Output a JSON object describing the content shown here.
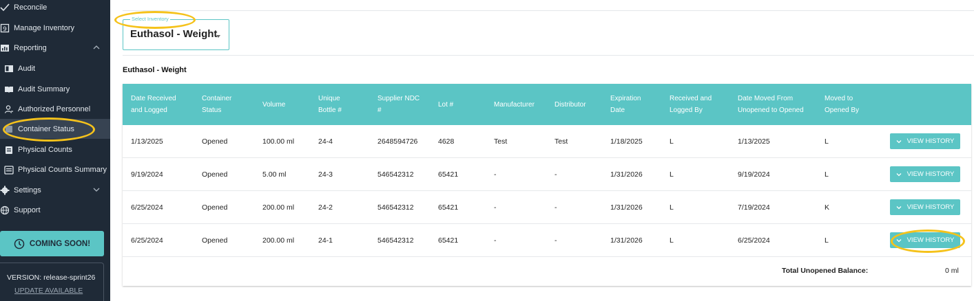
{
  "sidebar": {
    "items": [
      {
        "label": "Reconcile",
        "icon": "check-icon"
      },
      {
        "label": "Manage Inventory",
        "icon": "inventory-icon"
      },
      {
        "label": "Reporting",
        "icon": "chart-icon"
      },
      {
        "label": "Audit",
        "icon": "audit-icon"
      },
      {
        "label": "Audit Summary",
        "icon": "book-icon"
      },
      {
        "label": "Authorized Personnel",
        "icon": "person-icon"
      },
      {
        "label": "Container Status",
        "icon": "container-icon"
      },
      {
        "label": "Physical Counts",
        "icon": "clipboard-icon"
      },
      {
        "label": "Physical Counts Summary",
        "icon": "summary-icon"
      },
      {
        "label": "Settings",
        "icon": "gear-icon"
      },
      {
        "label": "Support",
        "icon": "globe-icon"
      }
    ],
    "coming_soon": "COMING SOON!",
    "version": "VERSION: release-sprint26",
    "update": "UPDATE AVAILABLE"
  },
  "inventory_select": {
    "legend": "Select Inventory",
    "value": "Euthasol - Weight"
  },
  "section_title": "Euthasol - Weight",
  "table": {
    "headers": [
      [
        "Date Received",
        "and Logged"
      ],
      [
        "Container",
        "Status"
      ],
      [
        "Volume"
      ],
      [
        "Unique",
        "Bottle #"
      ],
      [
        "Supplier NDC",
        "#"
      ],
      [
        "Lot #"
      ],
      [
        "Manufacturer"
      ],
      [
        "Distributor"
      ],
      [
        "Expiration",
        "Date"
      ],
      [
        "Received and",
        "Logged By"
      ],
      [
        "Date Moved From",
        "Unopened to Opened"
      ],
      [
        "Moved to",
        "Opened By"
      ]
    ],
    "rows": [
      [
        "1/13/2025",
        "Opened",
        "100.00 ml",
        "24-4",
        "2648594726",
        "4628",
        "Test",
        "Test",
        "1/18/2025",
        "L",
        "1/13/2025",
        "L"
      ],
      [
        "9/19/2024",
        "Opened",
        "5.00 ml",
        "24-3",
        "546542312",
        "65421",
        "-",
        "-",
        "1/31/2026",
        "L",
        "9/19/2024",
        "L"
      ],
      [
        "6/25/2024",
        "Opened",
        "200.00 ml",
        "24-2",
        "546542312",
        "65421",
        "-",
        "-",
        "1/31/2026",
        "L",
        "7/19/2024",
        "K"
      ],
      [
        "6/25/2024",
        "Opened",
        "200.00 ml",
        "24-1",
        "546542312",
        "65421",
        "-",
        "-",
        "1/31/2026",
        "L",
        "6/25/2024",
        "L"
      ]
    ],
    "action_label": "VIEW HISTORY",
    "total_label": "Total Unopened Balance:",
    "total_value": "0 ml"
  },
  "colors": {
    "sidebar_bg": "#1f2a37",
    "accent": "#5bc5c5",
    "highlight": "#f5c21b"
  }
}
